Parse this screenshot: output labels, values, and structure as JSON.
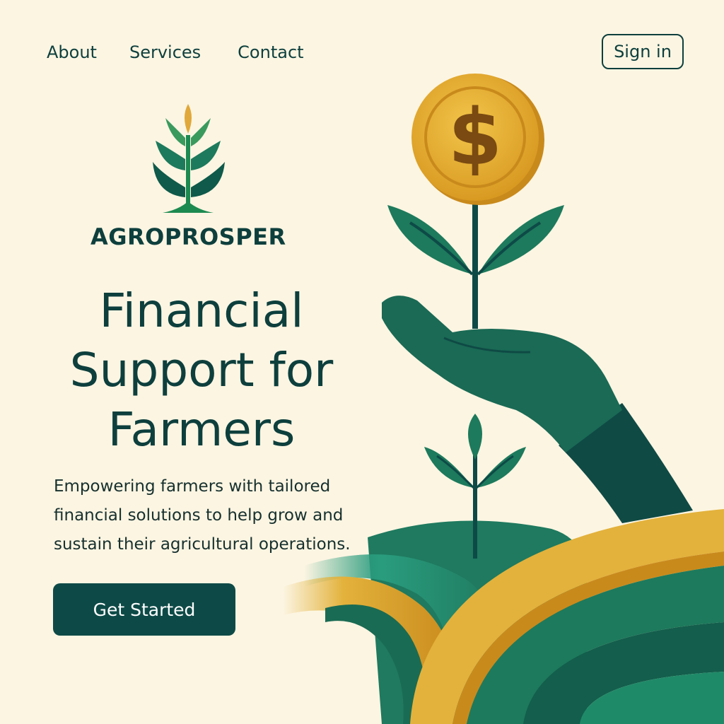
{
  "nav": {
    "items": [
      {
        "label": "About"
      },
      {
        "label": "Services"
      },
      {
        "label": "Contact"
      }
    ],
    "sign_in_label": "Sign in"
  },
  "brand": {
    "name": "AGROPROSPER",
    "logo_icon": "sprout-icon"
  },
  "hero": {
    "headline_lines": [
      "Financial",
      "Support for",
      "Farmers"
    ],
    "description": "Empowering farmers with tailored financial solutions to help grow and sustain their agricultural operations.",
    "cta_label": "Get Started",
    "illustration": "hand-holding-sprout-with-dollar-coin",
    "coin_symbol": "$"
  },
  "colors": {
    "background": "#fcf5e2",
    "primary_dark": "#0d3f3d",
    "green": "#1d7a5c",
    "gold": "#e3b23c"
  }
}
